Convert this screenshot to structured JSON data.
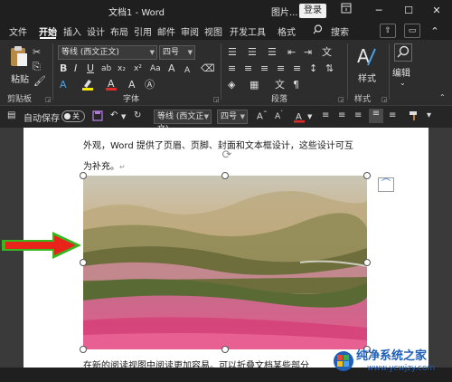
{
  "titlebar": {
    "doc_title": "文档1 - Word",
    "context_tab": "图片...",
    "login_label": "登录",
    "ribbon_display_icon": "ribbon-display-icon",
    "minimize_glyph": "─",
    "restore_glyph": "☐",
    "close_glyph": "✕"
  },
  "tabs": [
    {
      "label": "文件"
    },
    {
      "label": "开始"
    },
    {
      "label": "插入"
    },
    {
      "label": "设计"
    },
    {
      "label": "布局"
    },
    {
      "label": "引用"
    },
    {
      "label": "邮件"
    },
    {
      "label": "审阅"
    },
    {
      "label": "视图"
    },
    {
      "label": "开发工具"
    },
    {
      "label": "格式"
    }
  ],
  "search": {
    "label": "搜索",
    "icon": "search-icon"
  },
  "ribbon": {
    "clipboard": {
      "paste_label": "粘贴",
      "group_label": "剪贴板"
    },
    "font": {
      "font_name": "等线 (西文正文)",
      "font_size": "四号",
      "group_label": "字体",
      "aa_label": "Aa",
      "a_label": "A"
    },
    "paragraph": {
      "group_label": "段落"
    },
    "styles": {
      "label": "样式",
      "group_label": "样式"
    },
    "editing": {
      "label": "编辑"
    }
  },
  "qat": {
    "autosave_label": "自动保存",
    "toggle_state": "关",
    "font_name": "等线 (西文正文)",
    "font_size": "四号"
  },
  "document": {
    "line1": "外观，Word 提供了页眉、页脚、封面和文本框设计，这些设计可互",
    "line2": "为补充。",
    "line3": "在新的阅读视图中阅读更加容易。可以折叠文档某些部分"
  },
  "watermark": {
    "name": "纯净系统之家",
    "url": "www.ycwjzy.com"
  },
  "colors": {
    "highlight": "#f5e800",
    "font_red": "#e02b2b",
    "arrow_red": "#e8231a",
    "arrow_green": "#35b81f",
    "watermark_blue": "#1f5fb5"
  }
}
